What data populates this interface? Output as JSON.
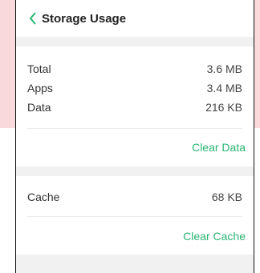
{
  "header": {
    "title": "Storage Usage",
    "back_icon": "chevron-left-icon"
  },
  "summary": {
    "rows": [
      {
        "label": "Total",
        "value": "3.6 MB"
      },
      {
        "label": "Apps",
        "value": "3.4 MB"
      },
      {
        "label": "Data",
        "value": "216 KB"
      }
    ],
    "clear_data_label": "Clear Data"
  },
  "cache": {
    "label": "Cache",
    "value": "68 KB",
    "clear_cache_label": "Clear Cache"
  },
  "colors": {
    "accent": "#2bb673",
    "band": "#f1f1f1",
    "background_pink": "#f9d9db"
  }
}
